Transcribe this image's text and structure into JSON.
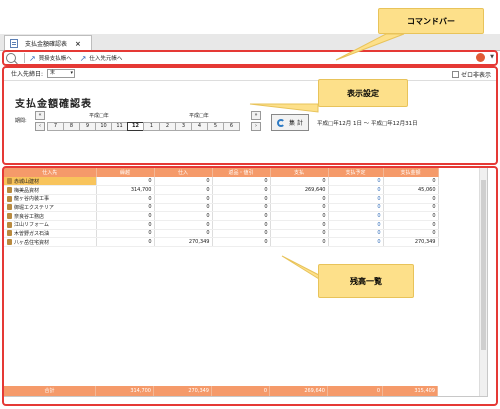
{
  "tab": {
    "title": "支払金額確認表",
    "close": "×"
  },
  "command_bar": {
    "items": [
      {
        "label": "買掛支払帳へ"
      },
      {
        "label": "仕入先元帳へ"
      }
    ]
  },
  "settings": {
    "fiscal_label": "仕入先締日:",
    "fiscal_value": "末",
    "hide_zero_label": "ゼロ非表示",
    "page_title": "支払金額確認表",
    "period_label": "期間:",
    "year_left": "平成□年",
    "year_right": "平成□年",
    "months": [
      "7",
      "8",
      "9",
      "10",
      "11",
      "12",
      "1",
      "2",
      "3",
      "4",
      "5",
      "6"
    ],
    "selected_month": "12",
    "calc_label": "集 計",
    "range_text": "平成□年12月 1日 ～ 平成□年12月31日"
  },
  "callouts": {
    "command": "コマンドバー",
    "settings": "表示設定",
    "list": "残高一覧"
  },
  "table": {
    "headers": [
      "仕入先",
      "繰越",
      "仕入",
      "返品・値引",
      "支払",
      "支払予定",
      "支払金額"
    ],
    "rows": [
      [
        "赤城山建材",
        "0",
        "0",
        "0",
        "0",
        "0",
        "0"
      ],
      [
        "梅美品資材",
        "314,700",
        "0",
        "0",
        "269,640",
        "0",
        "45,060"
      ],
      [
        "龍ヶ谷内装工事",
        "0",
        "0",
        "0",
        "0",
        "0",
        "0"
      ],
      [
        "御堀エクステリア",
        "0",
        "0",
        "0",
        "0",
        "0",
        "0"
      ],
      [
        "奈良谷工務店",
        "0",
        "0",
        "0",
        "0",
        "0",
        "0"
      ],
      [
        "江山リフォーム",
        "0",
        "0",
        "0",
        "0",
        "0",
        "0"
      ],
      [
        "木曽野ガス石油",
        "0",
        "0",
        "0",
        "0",
        "0",
        "0"
      ],
      [
        "八ヶ岳住宅資材",
        "0",
        "270,349",
        "0",
        "0",
        "0",
        "270,349"
      ]
    ],
    "total": [
      "合計",
      "314,700",
      "270,349",
      "0",
      "269,640",
      "0",
      "315,409"
    ]
  }
}
